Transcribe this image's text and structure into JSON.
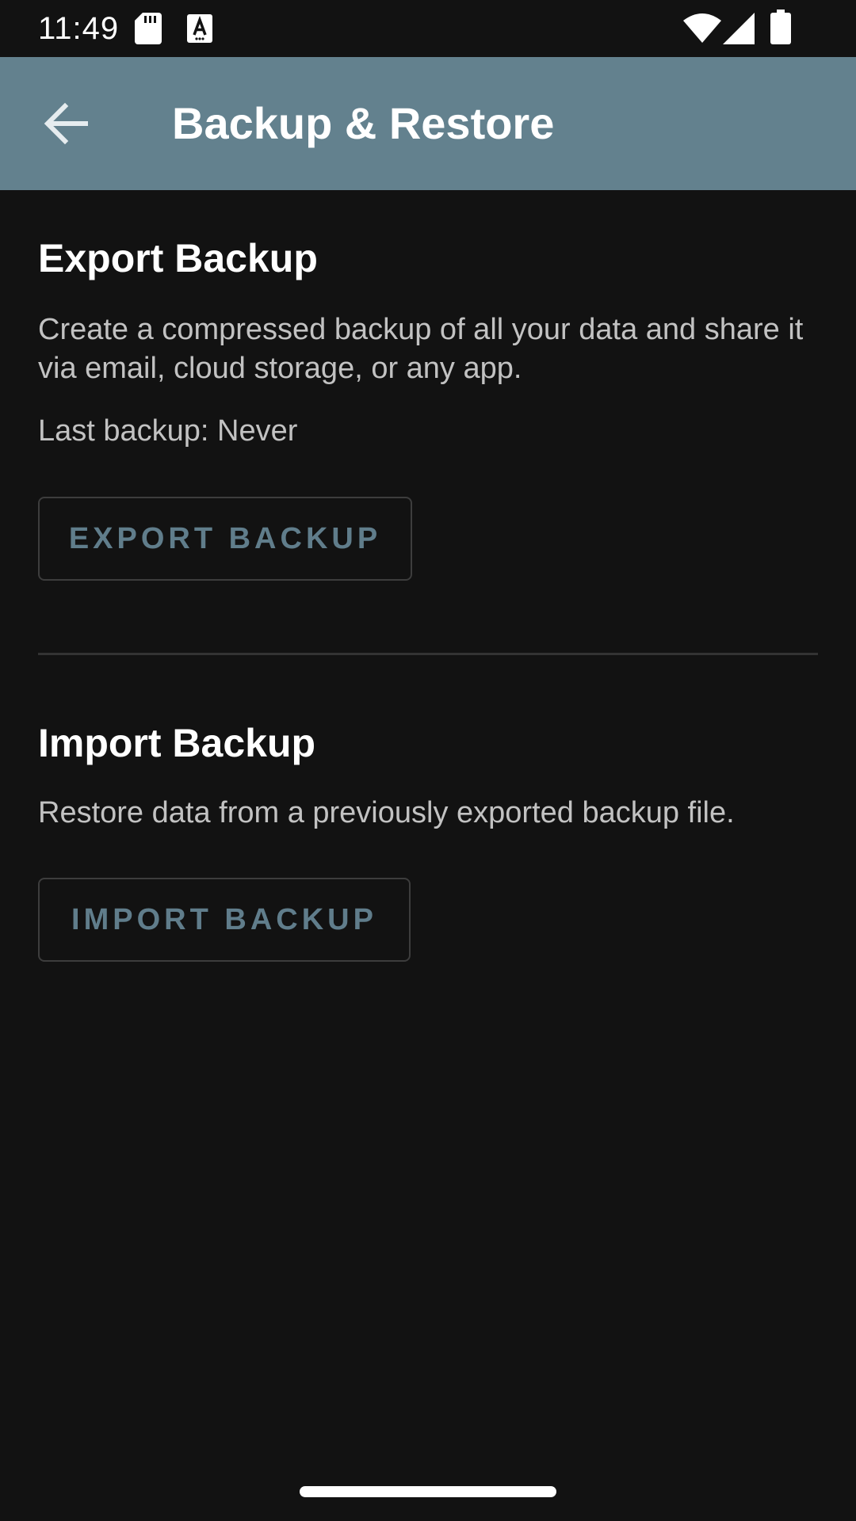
{
  "status_bar": {
    "time": "11:49",
    "icons": [
      "sd-card-icon",
      "a-notification-icon",
      "wifi-icon",
      "signal-icon",
      "battery-icon"
    ]
  },
  "app_bar": {
    "title": "Backup & Restore",
    "back_icon": "arrow-back-icon",
    "background_color": "#63818e"
  },
  "export_section": {
    "title": "Export Backup",
    "description": "Create a compressed backup of all your data and share it via email, cloud storage, or any app.",
    "last_backup": "Last backup: Never",
    "button_label": "EXPORT BACKUP"
  },
  "import_section": {
    "title": "Import Backup",
    "description": "Restore data from a previously exported backup file.",
    "button_label": "IMPORT BACKUP"
  },
  "colors": {
    "background": "#121212",
    "accent": "#607d8b",
    "body_text": "#c2c2c2"
  }
}
